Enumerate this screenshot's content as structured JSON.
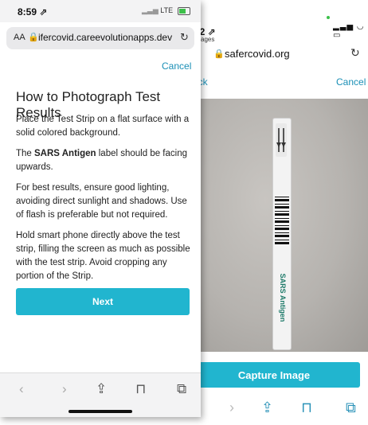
{
  "back_phone": {
    "status_time": "22 ⇗",
    "back_app": "ssages",
    "url_host": "safercovid.org",
    "back_label": "Back",
    "cancel_label": "Cancel",
    "strip_text": "SARS Antigen",
    "capture_button": "Capture Image",
    "icons": [
      "chevron-right-icon",
      "share-icon",
      "bookmarks-icon",
      "tabs-icon"
    ]
  },
  "front_phone": {
    "status_time": "8:59 ⇗",
    "network": "LTE",
    "url_prefix": "AA",
    "url_host": "ifercovid.careevolutionapps.dev",
    "cancel_label": "Cancel",
    "title": "How to Photograph Test Results",
    "paragraphs": [
      "Place the Test Strip on a flat surface with a solid colored background.",
      "The SARS Antigen label should be facing upwards.",
      "For best results, ensure good lighting, avoiding direct sunlight and shadows. Use of flash is preferable but not required.",
      "Hold smart phone directly above the test strip, filling the screen as much as possible with the test strip. Avoid cropping any portion of the Strip."
    ],
    "bold_term": "SARS Antigen",
    "next_button": "Next",
    "toolbar_icons": [
      "back-icon",
      "forward-icon",
      "share-icon",
      "bookmarks-icon",
      "tabs-icon"
    ]
  },
  "colors": {
    "accent": "#21b5cf",
    "link": "#1a8fb6"
  }
}
